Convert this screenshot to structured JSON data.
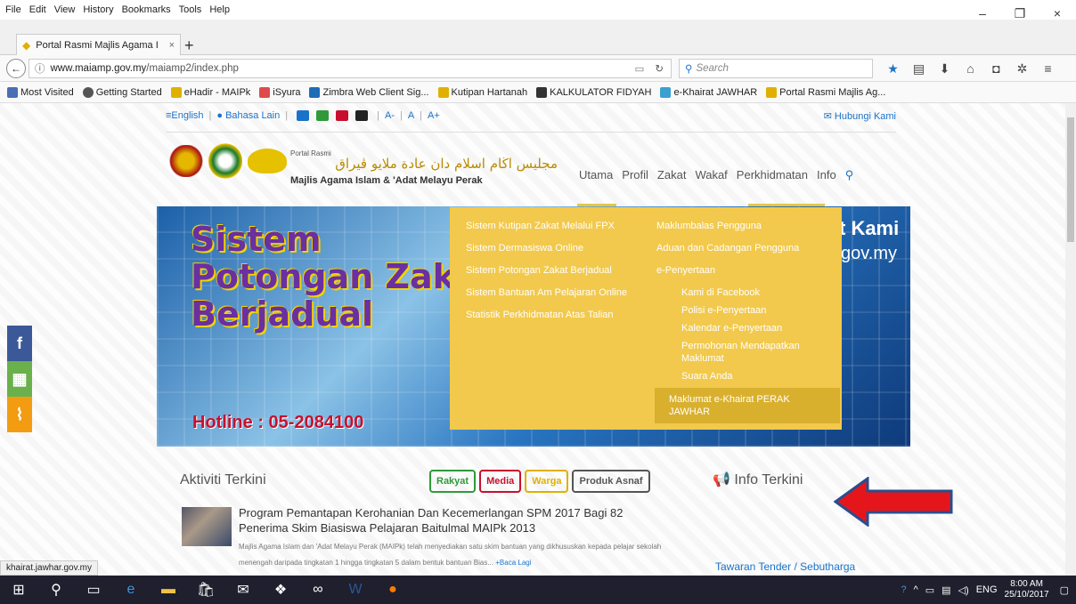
{
  "menubar": {
    "items": [
      "File",
      "Edit",
      "View",
      "History",
      "Bookmarks",
      "Tools",
      "Help"
    ]
  },
  "tab": {
    "title": "Portal Rasmi Majlis Agama I",
    "close": "×",
    "new": "+"
  },
  "window": {
    "minimize": "–",
    "restore": "❐",
    "close": "×"
  },
  "url": {
    "host": "www.maiamp.gov.my",
    "path": "/maiamp2/index.php",
    "search_placeholder": "Search"
  },
  "bookmarks": [
    {
      "label": "Most Visited",
      "color": "#4a6fb5"
    },
    {
      "label": "Getting Started",
      "color": "#555"
    },
    {
      "label": "eHadir - MAIPk",
      "color": "#e0b000"
    },
    {
      "label": "iSyura",
      "color": "#e04a4a"
    },
    {
      "label": "Zimbra Web Client Sig...",
      "color": "#1e6bb8"
    },
    {
      "label": "Kutipan Hartanah",
      "color": "#e0b000"
    },
    {
      "label": "KALKULATOR FIDYAH",
      "color": "#333"
    },
    {
      "label": "e-Khairat JAWHAR",
      "color": "#3aa0d0"
    },
    {
      "label": "Portal Rasmi Majlis Ag...",
      "color": "#e0b000"
    }
  ],
  "topstrip": {
    "english": "English",
    "bahasa": "Bahasa Lain",
    "a_minus": "A-",
    "a": "A",
    "a_plus": "A+",
    "contact": "Hubungi Kami"
  },
  "header": {
    "portal_rasmi": "Portal Rasmi",
    "arabic": "مجليس اڬام اسلام دان عادة ملايو ڤيراق",
    "name": "Majlis Agama Islam & 'Adat Melayu Perak"
  },
  "nav": [
    "Utama",
    "Profil",
    "Zakat",
    "Wakaf",
    "Perkhidmatan",
    "Info"
  ],
  "banner": {
    "line1": "Sistem",
    "line2": "Potongan Zakat",
    "line3": "Berjadual",
    "hotline": "Hotline : 05-2084100",
    "right1": "t Kami",
    "right2": "gov.my"
  },
  "dropdown": {
    "col1": [
      "Sistem Kutipan Zakat Melalui FPX",
      "Sistem Dermasiswa Online",
      "Sistem Potongan Zakat Berjadual",
      "Sistem Bantuan Am Pelajaran Online",
      "Statistik Perkhidmatan Atas Talian"
    ],
    "col2": [
      "Maklumbalas Pengguna",
      "Aduan dan Cadangan Pengguna",
      "e-Penyertaan"
    ],
    "col2_sub": [
      "Kami di Facebook",
      "Polisi e-Penyertaan",
      "Kalendar e-Penyertaan",
      "Permohonan Mendapatkan Maklumat",
      "Suara Anda"
    ],
    "highlight": "Maklumat e-Khairat PERAK JAWHAR"
  },
  "section": {
    "aktiviti": "Aktiviti Terkini",
    "info": "Info Terkini",
    "tender": "Tawaran Tender / Sebutharga"
  },
  "filters": [
    {
      "label": "Rakyat",
      "color": "#2e9a3a"
    },
    {
      "label": "Media",
      "color": "#c8102e"
    },
    {
      "label": "Warga",
      "color": "#e0b000"
    },
    {
      "label": "Produk Asnaf",
      "color": "#555"
    }
  ],
  "news": {
    "title": "Program Pemantapan Kerohanian Dan Kecemerlangan SPM 2017 Bagi 82 Penerima Skim Biasiswa Pelajaran Baitulmal MAIPk 2013",
    "desc": "Majlis Agama Islam dan 'Adat Melayu Perak (MAIPk) telah menyediakan satu skim bantuan yang dikhususkan kepada pelajar sekolah menengah daripada tingkatan 1 hingga tingkatan 5 dalam bentuk bantuan Bias...",
    "more": "+Baca Lagi"
  },
  "status": "khairat.jawhar.gov.my",
  "tray": {
    "lang": "ENG",
    "time": "8:00 AM",
    "date": "25/10/2017"
  }
}
